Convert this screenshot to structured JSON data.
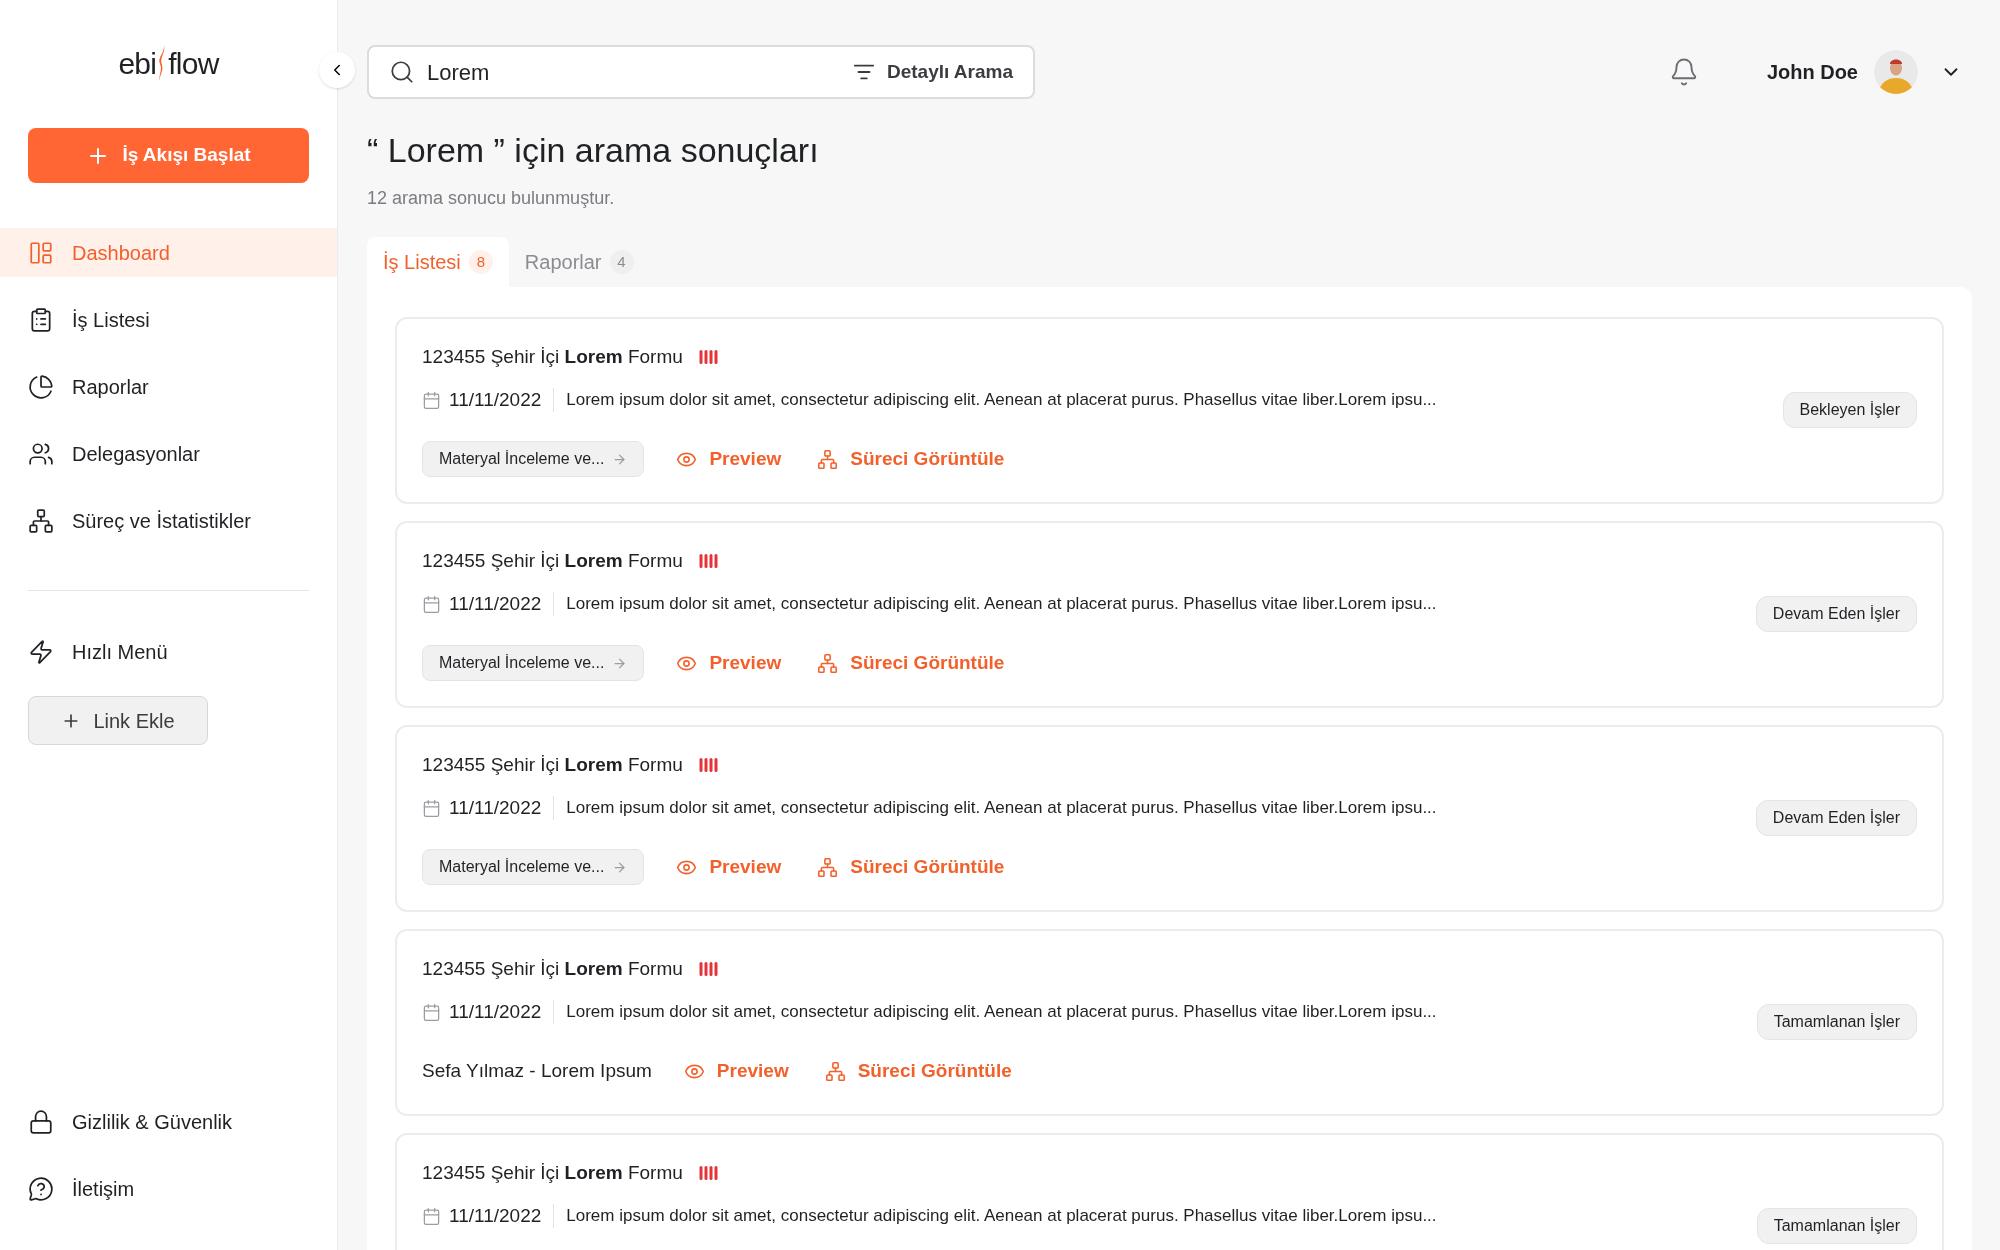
{
  "sidebar": {
    "logo": {
      "left": "ebi",
      "right": "flow"
    },
    "start_button": "İş Akışı Başlat",
    "nav_items": [
      {
        "label": "Dashboard",
        "selected": true
      },
      {
        "label": "İş Listesi",
        "selected": false
      },
      {
        "label": "Raporlar",
        "selected": false
      },
      {
        "label": "Delegasyonlar",
        "selected": false
      },
      {
        "label": "Süreç ve İstatistikler",
        "selected": false
      }
    ],
    "quick_menu": {
      "label": "Hızlı Menü",
      "add_link_button": "Link Ekle"
    },
    "bottom_items": [
      {
        "label": "Gizlilik & Güvenlik"
      },
      {
        "label": "İletişim"
      }
    ]
  },
  "search": {
    "value": "Lorem",
    "advanced_button": "Detaylı Arama"
  },
  "user": {
    "name": "John Doe"
  },
  "results": {
    "title": "“ Lorem ” için arama sonuçları",
    "subtitle": "12 arama sonucu bulunmuştur.",
    "tabs": [
      {
        "label": "İş Listesi",
        "count": "8",
        "selected": true
      },
      {
        "label": "Raporlar",
        "count": "4",
        "selected": false
      }
    ],
    "cards": [
      {
        "title": "123455 Şehir İçi **Lorem** Formu",
        "date": "11/11/2022",
        "description": "Lorem ipsum dolor sit amet, consectetur adipiscing elit. Aenean at placerat purus. Phasellus vitae liber.Lorem ipsu...",
        "status": "Bekleyen İşler",
        "footer": {
          "kind": "step",
          "text": "Materyal İnceleme ve...",
          "preview": "Preview",
          "process": "Süreci Görüntüle"
        }
      },
      {
        "title": "123455 Şehir İçi **Lorem** Formu",
        "date": "11/11/2022",
        "description": "Lorem ipsum dolor sit amet, consectetur adipiscing elit. Aenean at placerat purus. Phasellus vitae liber.Lorem ipsu...",
        "status": "Devam Eden İşler",
        "footer": {
          "kind": "step",
          "text": "Materyal İnceleme ve...",
          "preview": "Preview",
          "process": "Süreci Görüntüle"
        }
      },
      {
        "title": "123455 Şehir İçi **Lorem** Formu",
        "date": "11/11/2022",
        "description": "Lorem ipsum dolor sit amet, consectetur adipiscing elit. Aenean at placerat purus. Phasellus vitae liber.Lorem ipsu...",
        "status": "Devam Eden İşler",
        "footer": {
          "kind": "step",
          "text": "Materyal İnceleme ve...",
          "preview": "Preview",
          "process": "Süreci Görüntüle"
        }
      },
      {
        "title": "123455 Şehir İçi **Lorem** Formu",
        "date": "11/11/2022",
        "description": "Lorem ipsum dolor sit amet, consectetur adipiscing elit. Aenean at placerat purus. Phasellus vitae liber.Lorem ipsu...",
        "status": "Tamamlanan İşler",
        "footer": {
          "kind": "person",
          "text": "Sefa Yılmaz - Lorem Ipsum",
          "preview": "Preview",
          "process": "Süreci Görüntüle"
        }
      },
      {
        "title": "123455 Şehir İçi **Lorem** Formu",
        "date": "11/11/2022",
        "description": "Lorem ipsum dolor sit amet, consectetur adipiscing elit. Aenean at placerat purus. Phasellus vitae liber.Lorem ipsu...",
        "status": "Tamamlanan İşler"
      }
    ]
  }
}
